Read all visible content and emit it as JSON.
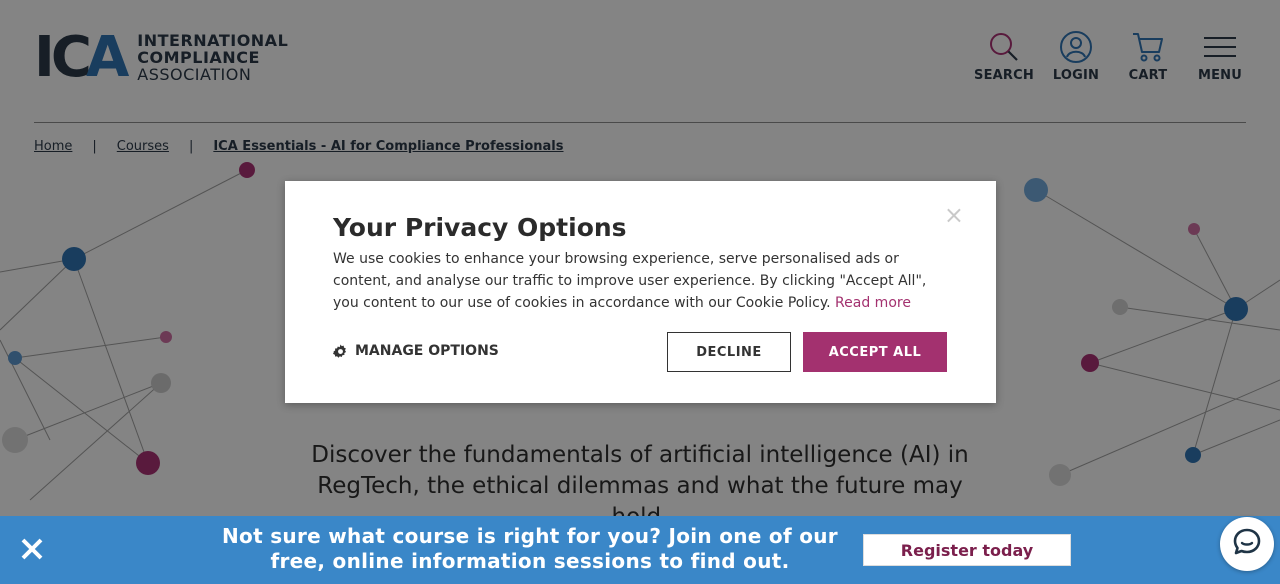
{
  "logo": {
    "mark_ic": "IC",
    "mark_a": "A",
    "line1": "INTERNATIONAL",
    "line2": "COMPLIANCE",
    "line3": "ASSOCIATION"
  },
  "nav": {
    "search": "SEARCH",
    "login": "LOGIN",
    "cart": "CART",
    "menu": "MENU"
  },
  "breadcrumb": {
    "home": "Home",
    "separator": "|",
    "courses": "Courses",
    "current": "ICA Essentials - AI for Compliance Professionals"
  },
  "intro": {
    "text": "Discover the fundamentals of artificial intelligence (AI) in RegTech, the ethical dilemmas and what the future may hold."
  },
  "privacy_modal": {
    "title": "Your Privacy Options",
    "body": "We use cookies to enhance your browsing experience, serve personalised ads or content, and analyse our traffic to improve user experience. By clicking \"Accept All\", you content to our use of cookies in accordance with our Cookie Policy.",
    "read_more": "Read more",
    "close_symbol": "×",
    "manage_options": "MANAGE OPTIONS",
    "decline": "DECLINE",
    "accept_all": "ACCEPT ALL"
  },
  "banner": {
    "text": "Not sure what course is right for you? Join one of our free, online information sessions to find out.",
    "cta": "Register today"
  },
  "icons": [
    "search-icon",
    "user-icon",
    "cart-icon",
    "hamburger-menu-icon",
    "gear-icon",
    "close-icon",
    "chat-icon"
  ],
  "colors": {
    "brand_dark": "#2a3846",
    "brand_blue": "#2e6fab",
    "accent_magenta": "#a3316f",
    "banner_blue": "#3a87c8"
  }
}
